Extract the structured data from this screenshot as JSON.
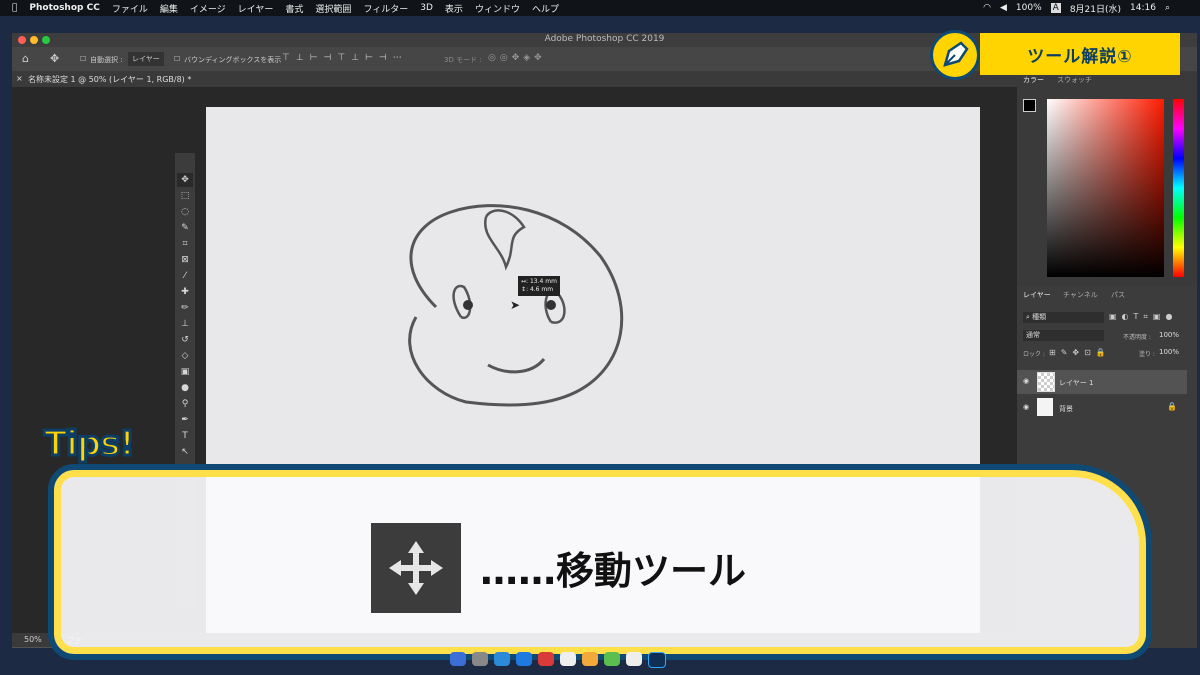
{
  "menubar": {
    "apple": "",
    "app_name": "Photoshop CC",
    "items": [
      "ファイル",
      "編集",
      "イメージ",
      "レイヤー",
      "書式",
      "選択範囲",
      "フィルター",
      "3D",
      "表示",
      "ウィンドウ",
      "ヘルプ"
    ],
    "battery": "100%",
    "input": "A",
    "date": "8月21日(水)",
    "time": "14:16"
  },
  "window": {
    "title": "Adobe Photoshop CC 2019",
    "options": {
      "auto_select": "自動選択 :",
      "layer_select": "レイヤー",
      "bounding_box": "バウンディングボックスを表示",
      "mode_3d": "3D モード :"
    },
    "doc_tab": "名称未設定 1 @ 50% (レイヤー 1, RGB/8) *",
    "zoom": "50%",
    "status": "ファ"
  },
  "canvas": {
    "readout_w": "↔: 13.4 mm",
    "readout_h": "↕:  4.6 mm"
  },
  "panels": {
    "color_tabs": [
      "カラー",
      "スウォッチ"
    ],
    "layer_tabs": [
      "レイヤー",
      "チャンネル",
      "パス"
    ],
    "filter_kind": "種類",
    "blend_mode": "通常",
    "opacity_label": "不透明度 :",
    "opacity_value": "100%",
    "lock_label": "ロック :",
    "fill_label": "塗り :",
    "fill_value": "100%",
    "layers": [
      {
        "name": "レイヤー 1",
        "selected": true
      },
      {
        "name": "背景",
        "selected": false
      }
    ]
  },
  "banner": {
    "title": "ツール解説①",
    "icon": "pen-nib-icon"
  },
  "tips": {
    "heading": "Tips!",
    "label": "……移動ツール",
    "icon": "move-arrows-icon"
  },
  "colors": {
    "accent_yellow": "#ffd400",
    "accent_navy": "#0e4a74"
  }
}
